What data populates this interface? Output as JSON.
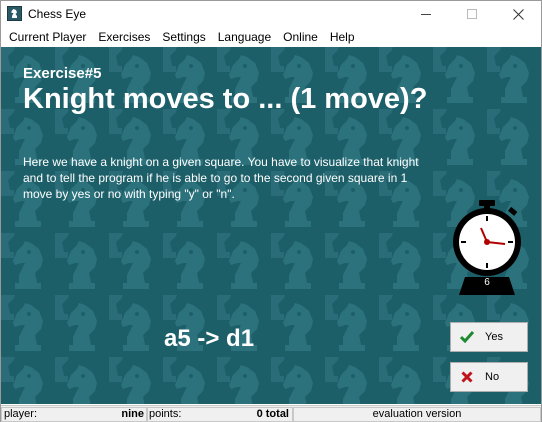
{
  "window": {
    "title": "Chess Eye",
    "icon": "knight-icon",
    "controls": [
      "minimize-icon",
      "maximize-icon",
      "close-icon"
    ]
  },
  "menu": {
    "items": [
      {
        "label": "Current Player"
      },
      {
        "label": "Exercises"
      },
      {
        "label": "Settings"
      },
      {
        "label": "Language"
      },
      {
        "label": "Online"
      },
      {
        "label": "Help"
      }
    ]
  },
  "exercise": {
    "number": "Exercise#5",
    "title": "Knight moves to ... (1 move)?",
    "description": "Here we have a knight on a given square. You have to visualize that knight and to tell the program if he is able to go to the second given square in 1 move by yes or no with typing \"y\" or \"n\".",
    "question": "a5 -> d1"
  },
  "timer": {
    "icon": "stopwatch-icon",
    "value": "6"
  },
  "answers": {
    "yes": {
      "label": "Yes",
      "icon": "checkmark-icon",
      "color": "#1e8a2e"
    },
    "no": {
      "label": "No",
      "icon": "x-icon",
      "color": "#c0141c"
    }
  },
  "status": {
    "player_label": "player:",
    "player_name": "nine",
    "points_label": "points:",
    "points_value": "0 total",
    "version": "evaluation version"
  },
  "colors": {
    "background": "#1d5f69",
    "pattern": "#2a6f7a"
  }
}
